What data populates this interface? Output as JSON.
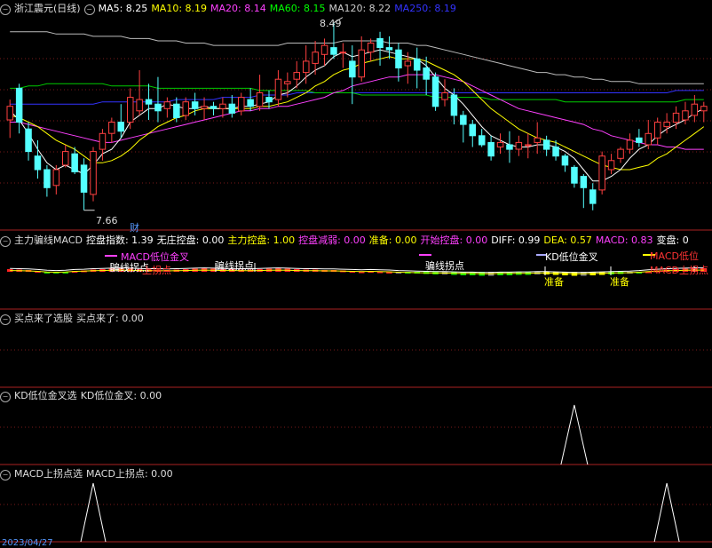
{
  "colors": {
    "up": "#ff4040",
    "down": "#54ffff",
    "ma5": "#ffffff",
    "ma10": "#ffff00",
    "ma20": "#ff40ff",
    "ma60": "#00cc00",
    "ma120": "#bbbbbb",
    "ma250": "#3333ff",
    "gridline": "#7a1a1a",
    "separator": "#aa2222"
  },
  "main_header": {
    "title": "浙江震元(日线)",
    "ma5": "MA5: 8.25",
    "ma10": "MA10: 8.19",
    "ma20": "MA20: 8.14",
    "ma60": "MA60: 8.15",
    "ma120": "MA120: 8.22",
    "ma250": "MA250: 8.19"
  },
  "main_annotations": {
    "high": "8.49",
    "low": "7.66",
    "cai": "财"
  },
  "ind_header": {
    "name": "主力骗线MACD",
    "kpzs": "控盘指数: 1.39",
    "wzkp": "无庄控盘: 0.00",
    "zlkp": "主力控盘: 1.00",
    "kpjr": "控盘减弱: 0.00",
    "zb": "准备: 0.00",
    "kskp": "开始控盘: 0.00",
    "diff": "DIFF: 0.99",
    "dea": "DEA: 0.57",
    "macd": "MACD: 0.83",
    "bp": "变盘: 0"
  },
  "ind_annotations": {
    "macd_low_cross": "MACD低位金叉",
    "piao1": "骗线拐点",
    "up_turn": "上拐点",
    "piao2": "骗线拐点",
    "piao3": "骗线拐点",
    "kd_low_cross": "KD低位金叉",
    "macd_low_cross2": "MACD低位",
    "macd_up_turn": "MACD上拐点",
    "zhunbei1": "准备",
    "zhunbei2": "准备"
  },
  "panel3_header": {
    "name": "买点来了选股",
    "value": "买点来了: 0.00"
  },
  "panel4_header": {
    "name": "KD低位金叉选",
    "value": "KD低位金叉: 0.00"
  },
  "panel5_header": {
    "name": "MACD上拐点选",
    "value": "MACD上拐点: 0.00"
  },
  "bottom_date": "2023/04/27",
  "chart_data": {
    "type": "candlestick",
    "ylim": [
      7.6,
      8.52
    ],
    "candles": [
      [
        8.06,
        8.12,
        7.98,
        8.15
      ],
      [
        8.2,
        8.05,
        8.0,
        8.22
      ],
      [
        8.02,
        7.92,
        7.88,
        8.05
      ],
      [
        7.9,
        7.84,
        7.8,
        7.97
      ],
      [
        7.84,
        7.76,
        7.72,
        7.86
      ],
      [
        7.77,
        7.84,
        7.73,
        7.86
      ],
      [
        7.86,
        7.92,
        7.85,
        7.95
      ],
      [
        7.91,
        7.83,
        7.82,
        7.94
      ],
      [
        7.86,
        7.74,
        7.66,
        7.89
      ],
      [
        7.73,
        7.92,
        7.7,
        7.94
      ],
      [
        7.93,
        8.0,
        7.88,
        8.02
      ],
      [
        8.0,
        8.05,
        7.96,
        8.07
      ],
      [
        8.05,
        8.01,
        7.98,
        8.13
      ],
      [
        8.05,
        8.16,
        8.02,
        8.2
      ],
      [
        8.1,
        8.15,
        8.08,
        8.28
      ],
      [
        8.15,
        8.13,
        8.06,
        8.22
      ],
      [
        8.13,
        8.1,
        8.05,
        8.25
      ],
      [
        8.11,
        8.14,
        8.07,
        8.16
      ],
      [
        8.13,
        8.07,
        8.05,
        8.16
      ],
      [
        8.08,
        8.14,
        8.06,
        8.16
      ],
      [
        8.14,
        8.11,
        8.08,
        8.18
      ],
      [
        8.11,
        8.12,
        8.06,
        8.16
      ],
      [
        8.12,
        8.11,
        8.08,
        8.14
      ],
      [
        8.11,
        8.13,
        8.07,
        8.16
      ],
      [
        8.13,
        8.09,
        8.07,
        8.17
      ],
      [
        8.1,
        8.16,
        8.08,
        8.18
      ],
      [
        8.15,
        8.12,
        8.1,
        8.2
      ],
      [
        8.12,
        8.18,
        8.1,
        8.26
      ],
      [
        8.16,
        8.14,
        8.11,
        8.19
      ],
      [
        8.15,
        8.24,
        8.12,
        8.28
      ],
      [
        8.22,
        8.23,
        8.16,
        8.27
      ],
      [
        8.24,
        8.27,
        8.2,
        8.32
      ],
      [
        8.27,
        8.32,
        8.22,
        8.39
      ],
      [
        8.31,
        8.36,
        8.26,
        8.41
      ],
      [
        8.35,
        8.39,
        8.3,
        8.42
      ],
      [
        8.38,
        8.35,
        8.33,
        8.49
      ],
      [
        8.36,
        8.36,
        8.29,
        8.4
      ],
      [
        8.32,
        8.25,
        8.13,
        8.39
      ],
      [
        8.25,
        8.37,
        8.23,
        8.43
      ],
      [
        8.36,
        8.4,
        8.32,
        8.42
      ],
      [
        8.42,
        8.38,
        8.3,
        8.45
      ],
      [
        8.38,
        8.37,
        8.33,
        8.43
      ],
      [
        8.37,
        8.29,
        8.23,
        8.4
      ],
      [
        8.3,
        8.32,
        8.22,
        8.36
      ],
      [
        8.33,
        8.28,
        8.2,
        8.38
      ],
      [
        8.29,
        8.24,
        8.17,
        8.34
      ],
      [
        8.25,
        8.12,
        8.1,
        8.27
      ],
      [
        8.15,
        8.18,
        8.12,
        8.24
      ],
      [
        8.17,
        8.08,
        8.04,
        8.2
      ],
      [
        8.08,
        8.04,
        7.96,
        8.1
      ],
      [
        8.04,
        7.99,
        7.94,
        8.06
      ],
      [
        7.99,
        7.95,
        7.94,
        8.02
      ],
      [
        7.96,
        7.9,
        7.88,
        7.99
      ],
      [
        7.94,
        7.96,
        7.91,
        8.0
      ],
      [
        7.95,
        7.93,
        7.87,
        8.01
      ],
      [
        7.93,
        7.96,
        7.9,
        7.99
      ],
      [
        7.95,
        7.95,
        7.89,
        8.0
      ],
      [
        7.96,
        7.98,
        7.91,
        8.05
      ],
      [
        7.97,
        7.93,
        7.9,
        7.99
      ],
      [
        7.94,
        7.9,
        7.88,
        7.97
      ],
      [
        7.9,
        7.86,
        7.83,
        7.91
      ],
      [
        7.85,
        7.78,
        7.76,
        7.86
      ],
      [
        7.81,
        7.76,
        7.67,
        7.82
      ],
      [
        7.75,
        7.69,
        7.66,
        7.78
      ],
      [
        7.75,
        7.9,
        7.73,
        7.92
      ],
      [
        7.84,
        7.88,
        7.82,
        7.91
      ],
      [
        7.89,
        7.93,
        7.87,
        7.94
      ],
      [
        7.93,
        7.97,
        7.91,
        8.0
      ],
      [
        7.98,
        7.96,
        7.94,
        8.02
      ],
      [
        7.95,
        8.0,
        7.93,
        8.06
      ],
      [
        7.98,
        8.05,
        7.95,
        8.07
      ],
      [
        8.03,
        8.05,
        8.0,
        8.09
      ],
      [
        8.05,
        8.09,
        8.02,
        8.12
      ],
      [
        8.06,
        8.1,
        8.04,
        8.14
      ],
      [
        8.08,
        8.13,
        8.05,
        8.17
      ],
      [
        8.1,
        8.12,
        8.05,
        8.14
      ]
    ],
    "ma5": [
      8.1,
      8.06,
      8.0,
      7.93,
      7.87,
      7.84,
      7.86,
      7.84,
      7.82,
      7.86,
      7.91,
      7.93,
      7.98,
      8.05,
      8.08,
      8.11,
      8.11,
      8.13,
      8.12,
      8.11,
      8.11,
      8.12,
      8.11,
      8.11,
      8.11,
      8.12,
      8.12,
      8.13,
      8.14,
      8.17,
      8.18,
      8.21,
      8.25,
      8.28,
      8.3,
      8.34,
      8.36,
      8.34,
      8.35,
      8.36,
      8.37,
      8.36,
      8.35,
      8.34,
      8.33,
      8.3,
      8.25,
      8.2,
      8.17,
      8.13,
      8.08,
      8.03,
      7.99,
      7.97,
      7.95,
      7.94,
      7.94,
      7.95,
      7.95,
      7.94,
      7.92,
      7.89,
      7.84,
      7.79,
      7.79,
      7.81,
      7.84,
      7.89,
      7.93,
      7.95,
      7.99,
      8.02,
      8.04,
      8.06,
      8.09,
      8.11
    ],
    "ma10": [
      8.08,
      8.07,
      8.05,
      8.03,
      8.0,
      7.97,
      7.95,
      7.93,
      7.9,
      7.87,
      7.87,
      7.88,
      7.9,
      7.93,
      7.97,
      8.0,
      8.03,
      8.05,
      8.07,
      8.08,
      8.1,
      8.11,
      8.11,
      8.11,
      8.11,
      8.11,
      8.11,
      8.12,
      8.12,
      8.13,
      8.14,
      8.16,
      8.18,
      8.21,
      8.23,
      8.26,
      8.28,
      8.29,
      8.31,
      8.32,
      8.33,
      8.34,
      8.33,
      8.33,
      8.33,
      8.32,
      8.3,
      8.28,
      8.26,
      8.23,
      8.19,
      8.15,
      8.11,
      8.08,
      8.05,
      8.02,
      8.0,
      7.98,
      7.97,
      7.96,
      7.94,
      7.92,
      7.9,
      7.88,
      7.86,
      7.85,
      7.84,
      7.84,
      7.85,
      7.86,
      7.89,
      7.91,
      7.94,
      7.97,
      8.0,
      8.03
    ],
    "ma20": [
      8.05,
      8.05,
      8.04,
      8.03,
      8.02,
      8.01,
      8.0,
      7.99,
      7.98,
      7.97,
      7.96,
      7.96,
      7.97,
      7.98,
      7.99,
      8.0,
      8.01,
      8.02,
      8.03,
      8.04,
      8.05,
      8.06,
      8.07,
      8.08,
      8.09,
      8.1,
      8.1,
      8.11,
      8.11,
      8.12,
      8.12,
      8.13,
      8.14,
      8.15,
      8.16,
      8.18,
      8.19,
      8.21,
      8.22,
      8.23,
      8.24,
      8.25,
      8.25,
      8.26,
      8.26,
      8.26,
      8.26,
      8.25,
      8.24,
      8.23,
      8.21,
      8.19,
      8.17,
      8.15,
      8.13,
      8.11,
      8.1,
      8.09,
      8.08,
      8.07,
      8.06,
      8.05,
      8.04,
      8.02,
      8.01,
      7.99,
      7.98,
      7.97,
      7.96,
      7.95,
      7.95,
      7.94,
      7.94,
      7.93,
      7.93,
      7.93
    ],
    "ma60": [
      8.2,
      8.2,
      8.21,
      8.21,
      8.22,
      8.22,
      8.22,
      8.22,
      8.22,
      8.22,
      8.22,
      8.21,
      8.21,
      8.21,
      8.21,
      8.21,
      8.2,
      8.2,
      8.2,
      8.2,
      8.2,
      8.2,
      8.2,
      8.2,
      8.2,
      8.2,
      8.2,
      8.19,
      8.19,
      8.19,
      8.19,
      8.19,
      8.19,
      8.18,
      8.18,
      8.18,
      8.18,
      8.18,
      8.17,
      8.17,
      8.17,
      8.17,
      8.17,
      8.17,
      8.17,
      8.17,
      8.16,
      8.16,
      8.16,
      8.16,
      8.16,
      8.16,
      8.15,
      8.15,
      8.15,
      8.15,
      8.15,
      8.15,
      8.15,
      8.15,
      8.14,
      8.14,
      8.14,
      8.14,
      8.14,
      8.14,
      8.14,
      8.14,
      8.14,
      8.14,
      8.14,
      8.14,
      8.14,
      8.15,
      8.15,
      8.15
    ],
    "ma120": [
      8.45,
      8.45,
      8.45,
      8.45,
      8.45,
      8.44,
      8.44,
      8.44,
      8.44,
      8.43,
      8.43,
      8.43,
      8.43,
      8.42,
      8.42,
      8.42,
      8.41,
      8.41,
      8.41,
      8.4,
      8.4,
      8.4,
      8.39,
      8.39,
      8.39,
      8.39,
      8.39,
      8.39,
      8.39,
      8.39,
      8.4,
      8.4,
      8.4,
      8.4,
      8.4,
      8.4,
      8.41,
      8.41,
      8.41,
      8.41,
      8.41,
      8.4,
      8.4,
      8.4,
      8.39,
      8.39,
      8.38,
      8.37,
      8.36,
      8.35,
      8.34,
      8.33,
      8.32,
      8.31,
      8.3,
      8.29,
      8.28,
      8.27,
      8.27,
      8.26,
      8.26,
      8.25,
      8.25,
      8.24,
      8.24,
      8.23,
      8.23,
      8.23,
      8.22,
      8.22,
      8.22,
      8.22,
      8.22,
      8.22,
      8.22,
      8.22
    ],
    "ma250": [
      8.13,
      8.13,
      8.13,
      8.13,
      8.13,
      8.13,
      8.13,
      8.13,
      8.13,
      8.13,
      8.14,
      8.14,
      8.14,
      8.14,
      8.14,
      8.14,
      8.14,
      8.14,
      8.15,
      8.15,
      8.15,
      8.15,
      8.15,
      8.16,
      8.16,
      8.16,
      8.16,
      8.17,
      8.17,
      8.17,
      8.17,
      8.18,
      8.18,
      8.18,
      8.18,
      8.18,
      8.18,
      8.18,
      8.18,
      8.18,
      8.18,
      8.18,
      8.18,
      8.18,
      8.18,
      8.18,
      8.18,
      8.18,
      8.18,
      8.18,
      8.18,
      8.18,
      8.18,
      8.18,
      8.18,
      8.18,
      8.18,
      8.18,
      8.18,
      8.18,
      8.18,
      8.18,
      8.18,
      8.18,
      8.18,
      8.18,
      8.18,
      8.18,
      8.18,
      8.18,
      8.18,
      8.18,
      8.19,
      8.19,
      8.19,
      8.19
    ],
    "macd_bars": [
      0.6,
      0.5,
      0.4,
      0.2,
      -0.1,
      -0.2,
      -0.1,
      0.2,
      0.3,
      0.5,
      0.6,
      0.7,
      0.8,
      0.7,
      0.6,
      0.5,
      0.5,
      0.4,
      0.5,
      0.6,
      0.7,
      0.8,
      0.7,
      0.6,
      0.6,
      0.5,
      0.5,
      0.6,
      0.7,
      0.8,
      0.7,
      0.6,
      0.5,
      0.5,
      0.4,
      0.4,
      0.3,
      0.2,
      0.1,
      0.2,
      0.1,
      0.0,
      -0.2,
      -0.3,
      -0.4,
      -0.5,
      -0.6,
      -0.6,
      -0.7,
      -0.8,
      -0.8,
      -0.9,
      -0.9,
      -0.8,
      -0.8,
      -0.7,
      -0.7,
      -0.6,
      -0.6,
      -0.7,
      -0.8,
      -0.9,
      -0.9,
      -0.8,
      -0.7,
      -0.6,
      -0.5,
      -0.4,
      -0.2,
      0.1,
      0.3,
      0.5,
      0.6,
      0.7,
      0.8,
      0.8
    ],
    "kd_signal_index": 61,
    "macd_turn_indices": [
      9,
      71
    ]
  }
}
